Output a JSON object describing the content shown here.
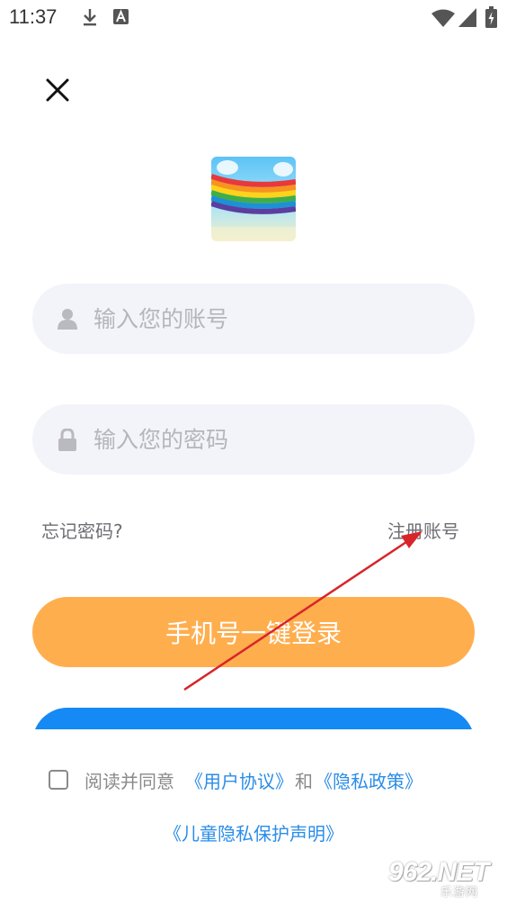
{
  "status_bar": {
    "time": "11:37",
    "left_icons": [
      "download-icon",
      "a-notification-icon"
    ],
    "right_icons": [
      "wifi-icon",
      "signal-icon",
      "battery-charging-icon"
    ]
  },
  "login": {
    "close_icon": "close-icon",
    "logo": "rainbow-app-logo",
    "account_placeholder": "输入您的账号",
    "password_placeholder": "输入您的密码",
    "forgot_password": "忘记密码?",
    "register": "注册账号",
    "phone_login": "手机号一键登录",
    "agree_prefix": "阅读并同意",
    "user_agreement": "《用户协议》",
    "and": "和",
    "privacy_policy": "《隐私政策》",
    "child_privacy": "《儿童隐私保护声明》"
  },
  "colors": {
    "primary_orange": "#ffae4e",
    "blue": "#1589f4",
    "link_blue": "#2a8de8",
    "field_bg": "#f3f4f9",
    "annotation_red": "#d8252a"
  },
  "watermark": {
    "main": "962.NET",
    "sub": "乐游网"
  }
}
